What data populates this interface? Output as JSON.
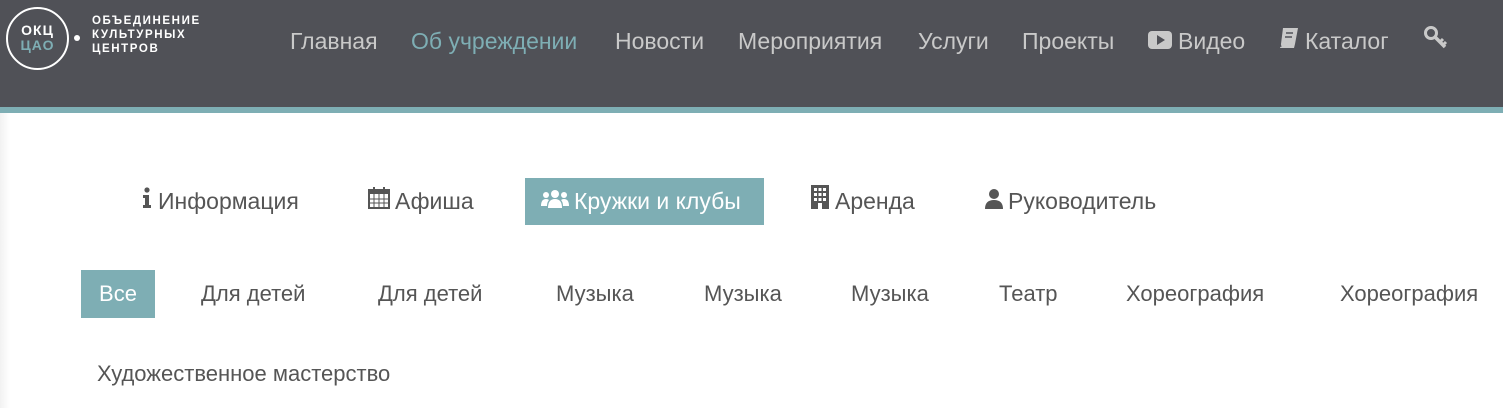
{
  "logo": {
    "abbr_line1": "ОКЦ",
    "abbr_line2": "ЦАО",
    "text_lines": [
      "ОБЪЕДИНЕНИЕ",
      "КУЛЬТУРНЫХ",
      "ЦЕНТРОВ"
    ]
  },
  "nav": {
    "items": [
      {
        "label": "Главная"
      },
      {
        "label": "Об учреждении"
      },
      {
        "label": "Новости"
      },
      {
        "label": "Мероприятия"
      },
      {
        "label": "Услуги"
      },
      {
        "label": "Проекты"
      },
      {
        "label": "Видео",
        "icon": "youtube-play-icon"
      },
      {
        "label": "Каталог",
        "icon": "book-icon"
      }
    ],
    "login_icon": "key-icon"
  },
  "tabs": [
    {
      "label": "Информация",
      "icon": "info-icon"
    },
    {
      "label": "Афиша",
      "icon": "calendar-icon"
    },
    {
      "label": "Кружки и клубы",
      "icon": "users-icon"
    },
    {
      "label": "Аренда",
      "icon": "building-icon"
    },
    {
      "label": "Руководитель",
      "icon": "user-icon"
    }
  ],
  "filters": [
    "Все",
    "Для детей",
    "Для детей",
    "Музыка",
    "Музыка",
    "Музыка",
    "Театр",
    "Хореография",
    "Хореография",
    "Художественное мастерство"
  ],
  "colors": {
    "accent": "#7eaeb4",
    "topbar": "#505157",
    "nav_text": "#c9c9c9",
    "body_text": "#555555"
  }
}
